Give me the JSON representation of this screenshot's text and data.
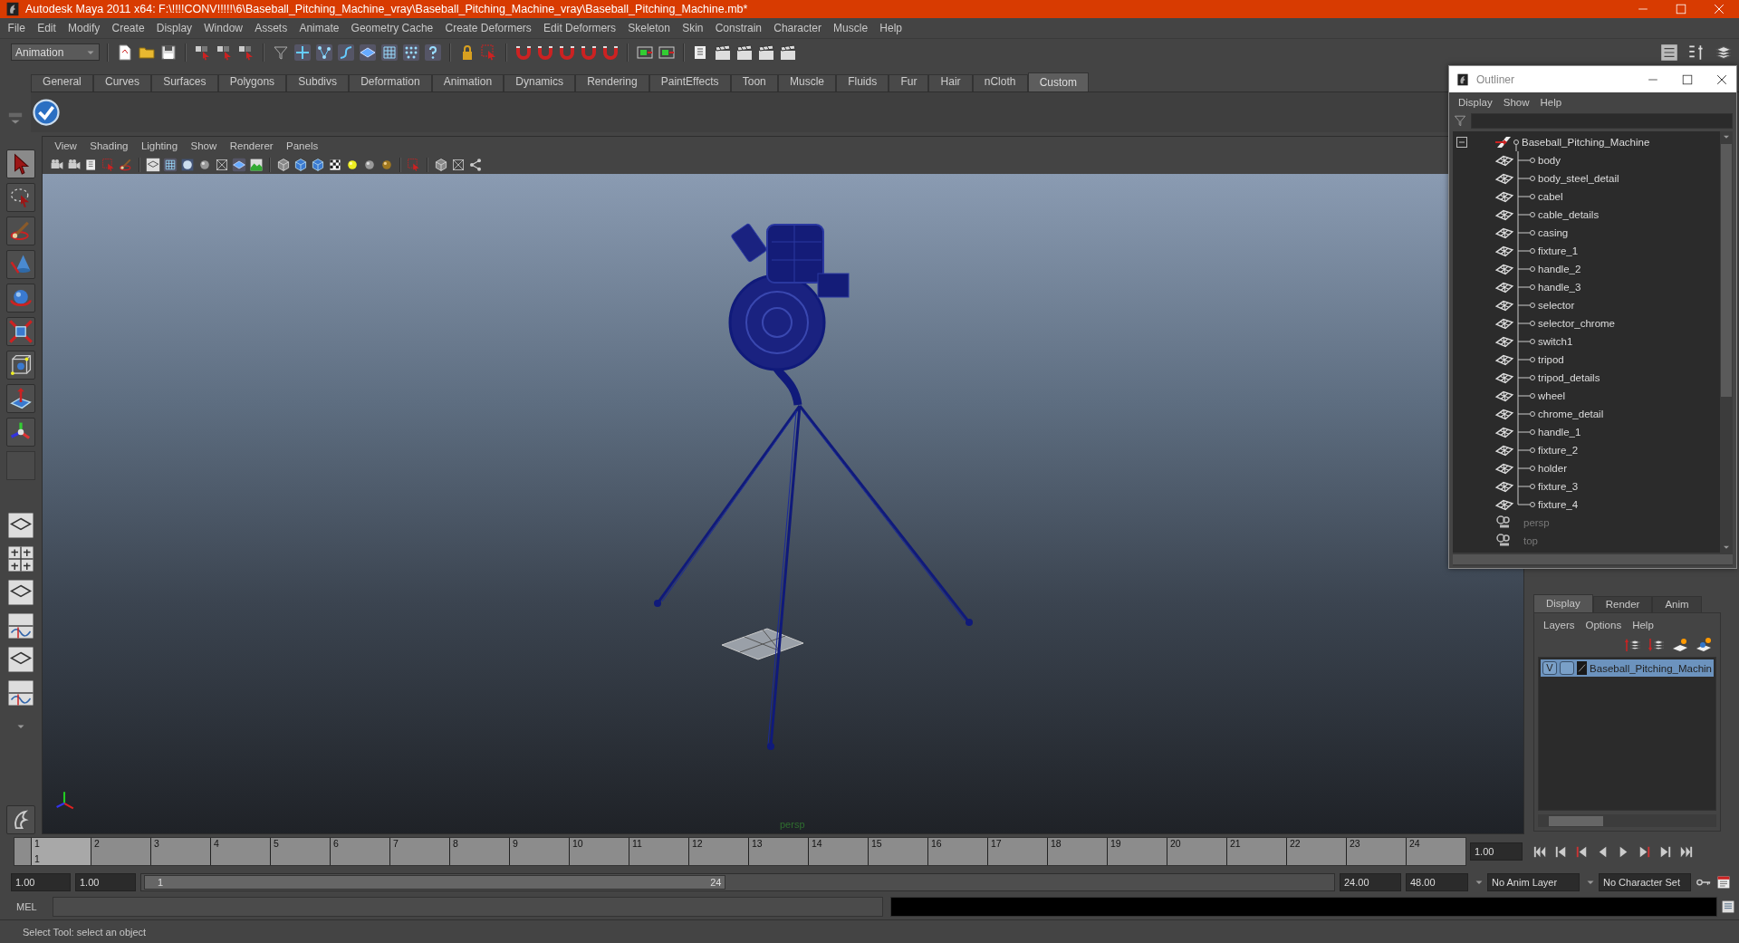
{
  "window": {
    "title": "Autodesk Maya 2011 x64: F:\\!!!!CONV!!!!!\\6\\Baseball_Pitching_Machine_vray\\Baseball_Pitching_Machine_vray\\Baseball_Pitching_Machine.mb*"
  },
  "menu_bar": [
    "File",
    "Edit",
    "Modify",
    "Create",
    "Display",
    "Window",
    "Assets",
    "Animate",
    "Geometry Cache",
    "Create Deformers",
    "Edit Deformers",
    "Skeleton",
    "Skin",
    "Constrain",
    "Character",
    "Muscle",
    "Help"
  ],
  "toolbar": {
    "mode": "Animation"
  },
  "shelf": {
    "tabs": [
      {
        "label": "General",
        "selected": false
      },
      {
        "label": "Curves",
        "selected": false
      },
      {
        "label": "Surfaces",
        "selected": false
      },
      {
        "label": "Polygons",
        "selected": false
      },
      {
        "label": "Subdivs",
        "selected": false
      },
      {
        "label": "Deformation",
        "selected": false
      },
      {
        "label": "Animation",
        "selected": false
      },
      {
        "label": "Dynamics",
        "selected": false
      },
      {
        "label": "Rendering",
        "selected": false
      },
      {
        "label": "PaintEffects",
        "selected": false
      },
      {
        "label": "Toon",
        "selected": false
      },
      {
        "label": "Muscle",
        "selected": false
      },
      {
        "label": "Fluids",
        "selected": false
      },
      {
        "label": "Fur",
        "selected": false
      },
      {
        "label": "Hair",
        "selected": false
      },
      {
        "label": "nCloth",
        "selected": false
      },
      {
        "label": "Custom",
        "selected": true
      }
    ]
  },
  "viewport": {
    "menu": [
      "View",
      "Shading",
      "Lighting",
      "Show",
      "Renderer",
      "Panels"
    ],
    "camera_label": "persp"
  },
  "outliner": {
    "title": "Outliner",
    "menu": [
      "Display",
      "Show",
      "Help"
    ],
    "tree": {
      "label": "Baseball_Pitching_Machine",
      "expanded": true,
      "children": [
        {
          "label": "body"
        },
        {
          "label": "body_steel_detail"
        },
        {
          "label": "cabel"
        },
        {
          "label": "cable_details"
        },
        {
          "label": "casing"
        },
        {
          "label": "fixture_1"
        },
        {
          "label": "handle_2"
        },
        {
          "label": "handle_3"
        },
        {
          "label": "selector"
        },
        {
          "label": "selector_chrome"
        },
        {
          "label": "switch1"
        },
        {
          "label": "tripod"
        },
        {
          "label": "tripod_details"
        },
        {
          "label": "wheel"
        },
        {
          "label": "chrome_detail"
        },
        {
          "label": "handle_1"
        },
        {
          "label": "fixture_2"
        },
        {
          "label": "holder"
        },
        {
          "label": "fixture_3"
        },
        {
          "label": "fixture_4"
        }
      ]
    },
    "cameras": [
      "persp",
      "top"
    ]
  },
  "layer_editor": {
    "tabs": [
      {
        "label": "Display",
        "selected": true
      },
      {
        "label": "Render",
        "selected": false
      },
      {
        "label": "Anim",
        "selected": false
      }
    ],
    "menu": [
      "Layers",
      "Options",
      "Help"
    ],
    "layers": [
      {
        "visibility": "V",
        "name": "Baseball_Pitching_Machin",
        "selected": true
      }
    ]
  },
  "timeline": {
    "frames": [
      {
        "label": "1",
        "selected": true
      },
      {
        "label": "2",
        "selected": false
      },
      {
        "label": "3",
        "selected": false
      },
      {
        "label": "4",
        "selected": false
      },
      {
        "label": "5",
        "selected": false
      },
      {
        "label": "6",
        "selected": false
      },
      {
        "label": "7",
        "selected": false
      },
      {
        "label": "8",
        "selected": false
      },
      {
        "label": "9",
        "selected": false
      },
      {
        "label": "10",
        "selected": false
      },
      {
        "label": "11",
        "selected": false
      },
      {
        "label": "12",
        "selected": false
      },
      {
        "label": "13",
        "selected": false
      },
      {
        "label": "14",
        "selected": false
      },
      {
        "label": "15",
        "selected": false
      },
      {
        "label": "16",
        "selected": false
      },
      {
        "label": "17",
        "selected": false
      },
      {
        "label": "18",
        "selected": false
      },
      {
        "label": "19",
        "selected": false
      },
      {
        "label": "20",
        "selected": false
      },
      {
        "label": "21",
        "selected": false
      },
      {
        "label": "22",
        "selected": false
      },
      {
        "label": "23",
        "selected": false
      },
      {
        "label": "24",
        "selected": false
      }
    ],
    "current_frame": "1",
    "current_time": "1.00"
  },
  "range": {
    "level": 0.49,
    "start": "1.00",
    "playback_start": "1.00",
    "slider_start": "1",
    "slider_end": "24",
    "playback_end": "24.00",
    "end": "48.00",
    "anim_layer": "No Anim Layer",
    "character_set": "No Character Set"
  },
  "command_line": {
    "label": "MEL"
  },
  "status": "Select Tool: select an object"
}
